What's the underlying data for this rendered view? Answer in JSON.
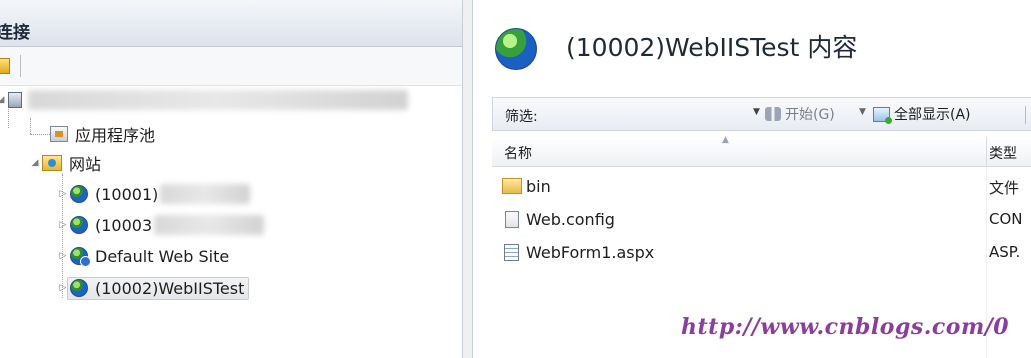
{
  "connections": {
    "title": "连接",
    "tree": [
      {
        "label": "应用程序池",
        "icon": "app-pool-icon"
      },
      {
        "label": "网站",
        "icon": "sites-folder-icon"
      },
      {
        "label": "(10001)",
        "icon": "globe-icon"
      },
      {
        "label": "(10003",
        "icon": "globe-icon"
      },
      {
        "label": "Default Web Site",
        "icon": "globe-icon"
      },
      {
        "label": "(10002)WebIISTest",
        "icon": "globe-icon",
        "selected": true
      }
    ]
  },
  "content": {
    "title": "(10002)WebIISTest 内容",
    "filter": {
      "label": "筛选:",
      "value": "",
      "start_label": "开始(G)",
      "show_all_label": "全部显示(A)"
    },
    "columns": [
      "名称",
      "类型"
    ],
    "files": [
      {
        "name": "bin",
        "type": "文件",
        "icon": "folder-icon"
      },
      {
        "name": "Web.config",
        "type": "CON",
        "icon": "config-file-icon"
      },
      {
        "name": "WebForm1.aspx",
        "type": "ASP.",
        "icon": "aspx-file-icon"
      }
    ],
    "watermark": "http://www.cnblogs.com/0"
  }
}
